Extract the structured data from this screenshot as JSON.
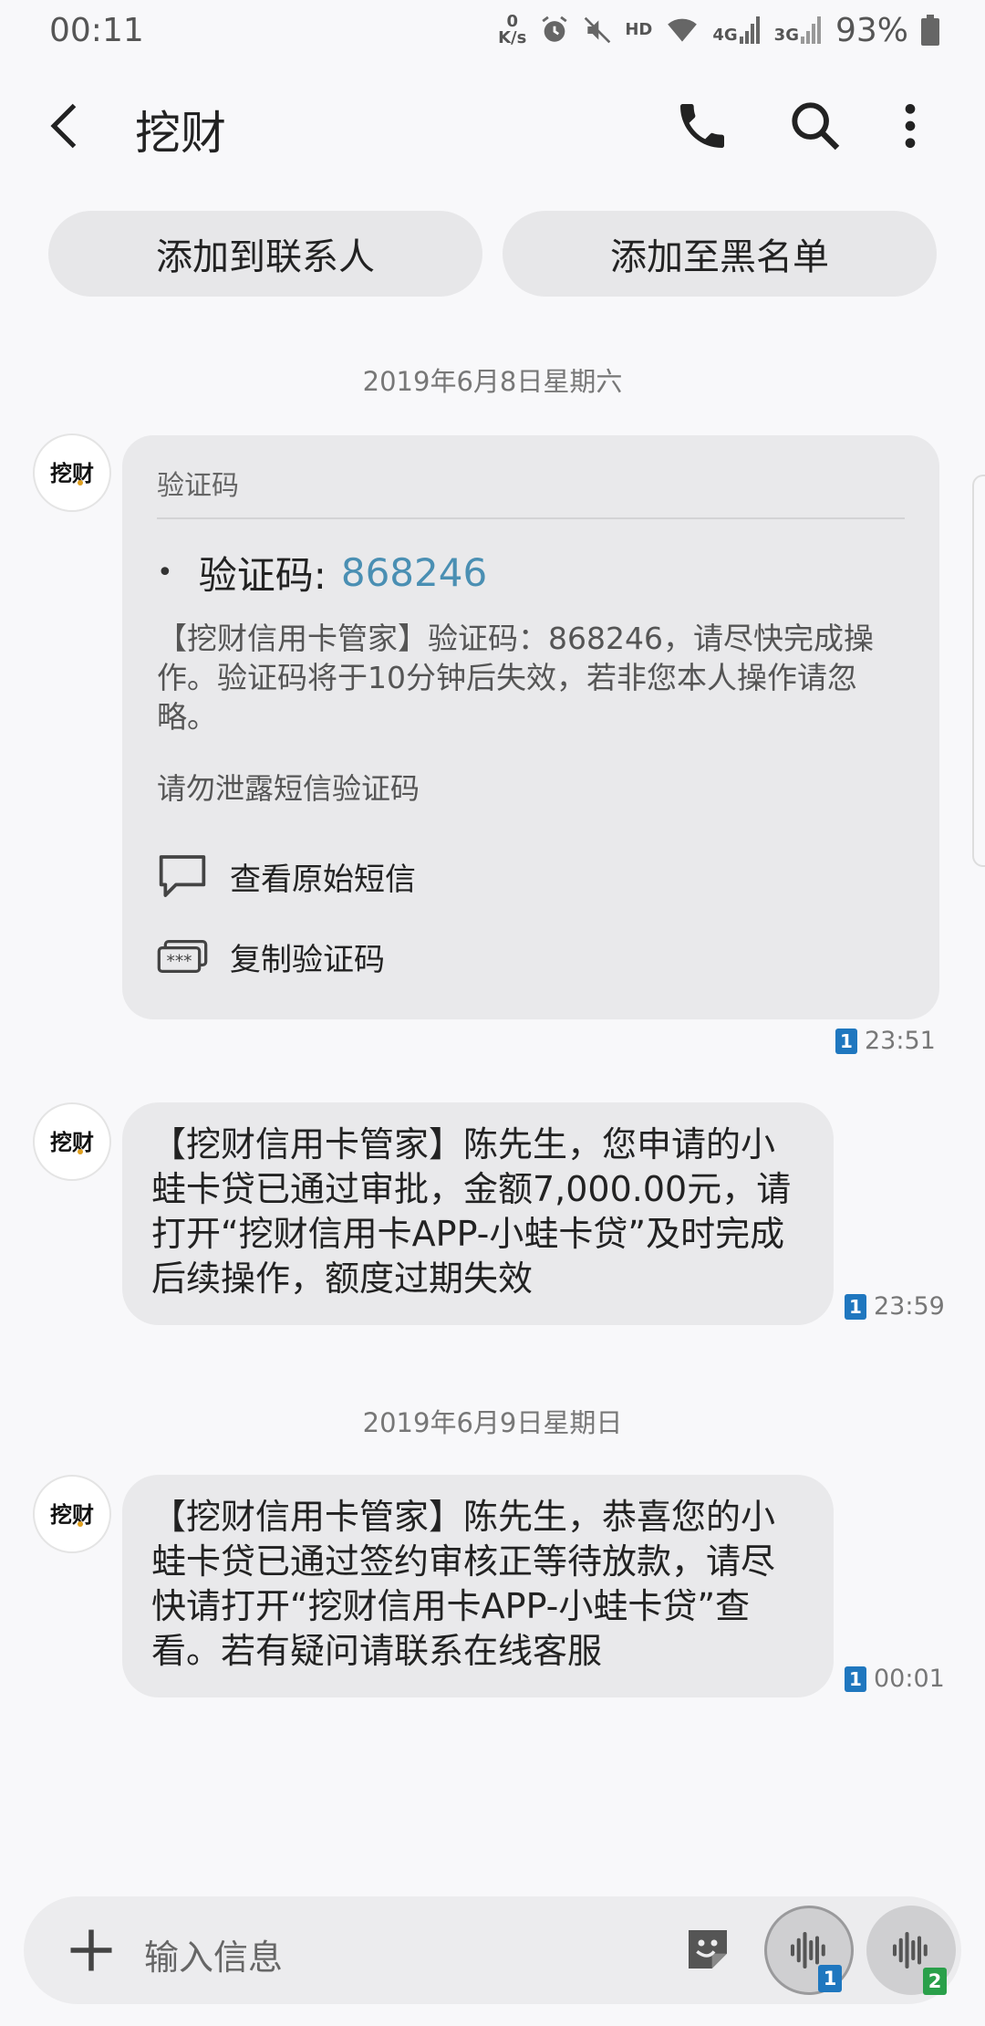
{
  "status_bar": {
    "time": "00:11",
    "net_speed_value": "0",
    "net_speed_unit": "K/s",
    "hd": "HD",
    "net_4g": "4G",
    "net_3g": "3G",
    "battery": "93%"
  },
  "header": {
    "title": "挖财"
  },
  "actions": {
    "add_contact": "添加到联系人",
    "add_blacklist": "添加至黑名单"
  },
  "avatar_label": "挖财",
  "messages": [
    {
      "date": "2019年6月8日星期六",
      "card_header": "验证码",
      "code_label": "验证码:",
      "code": "868246",
      "body": "【挖财信用卡管家】验证码：868246，请尽快完成操作。验证码将于10分钟后失效，若非您本人操作请忽略。",
      "warning": "请勿泄露短信验证码",
      "view_original": "查看原始短信",
      "copy_code": "复制验证码",
      "sim": "1",
      "time": "23:51"
    },
    {
      "text": "【挖财信用卡管家】陈先生，您申请的小蛙卡贷已通过审批，金额7,000.00元，请打开“挖财信用卡APP-小蛙卡贷”及时完成后续操作，额度过期失效",
      "sim": "1",
      "time": "23:59"
    },
    {
      "date": "2019年6月9日星期日",
      "text": "【挖财信用卡管家】陈先生，恭喜您的小蛙卡贷已通过签约审核正等待放款，请尽快请打开“挖财信用卡APP-小蛙卡贷”查看。若有疑问请联系在线客服",
      "sim": "1",
      "time": "00:01"
    }
  ],
  "composer": {
    "placeholder": "输入信息",
    "sim1_badge": "1",
    "sim2_badge": "2"
  },
  "colors": {
    "code_link": "#4a8fb3",
    "sim1": "#1f77bf",
    "sim2": "#2aa04a",
    "bubble": "#e9e9eb"
  }
}
